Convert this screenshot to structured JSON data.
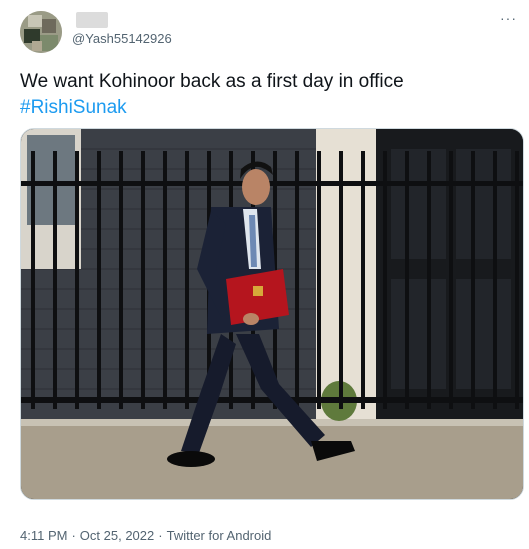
{
  "tweet": {
    "author": {
      "handle": "@Yash55142926"
    },
    "text": "We want Kohinoor back as a first day in office",
    "hashtag": "#RishiSunak",
    "more_icon": "···",
    "media": {
      "description_icon": "photo-image"
    },
    "meta": {
      "time": "4:11 PM",
      "separator": "·",
      "date": "Oct 25, 2022",
      "source": "Twitter for Android"
    }
  },
  "colors": {
    "link": "#1d9bf0",
    "secondary_text": "#536471",
    "primary_text": "#0f1419",
    "border": "#cfd9de"
  }
}
